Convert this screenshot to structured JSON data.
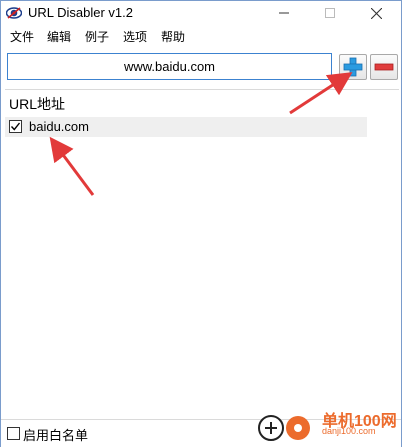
{
  "window": {
    "title": "URL Disabler v1.2"
  },
  "menu": {
    "items": [
      "文件",
      "编辑",
      "例子",
      "选项",
      "帮助"
    ]
  },
  "toolbar": {
    "url_value": "www.baidu.com"
  },
  "list": {
    "header": "URL地址",
    "rows": [
      {
        "label": "baidu.com",
        "checked": true
      }
    ]
  },
  "footer": {
    "whitelist_label": "启用白名单",
    "whitelist_checked": false
  },
  "watermark": {
    "text": "单机100网",
    "domain": "danji100.com"
  },
  "colors": {
    "accent_blue": "#3c82d0",
    "add_blue": "#2b9be0",
    "remove_red": "#e03c3c",
    "arrow_red": "#e23a3a"
  }
}
